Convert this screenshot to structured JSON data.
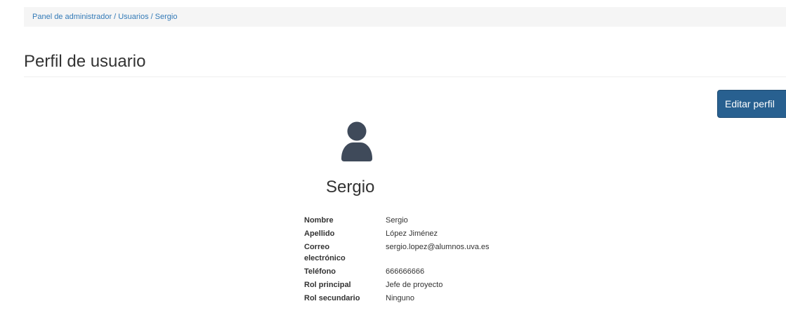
{
  "breadcrumb": {
    "items": [
      "Panel de administrador",
      "Usuarios",
      "Sergio"
    ],
    "separator": "/"
  },
  "page": {
    "title": "Perfil de usuario"
  },
  "actions": {
    "edit_label": "Editar perfil"
  },
  "profile": {
    "avatar_icon": "user-icon",
    "name": "Sergio",
    "fields": {
      "nombre": {
        "label": "Nombre",
        "value": "Sergio"
      },
      "apellido": {
        "label": "Apellido",
        "value": "López Jiménez"
      },
      "correo": {
        "label": "Correo electrónico",
        "value": "sergio.lopez@alumnos.uva.es"
      },
      "telefono": {
        "label": "Teléfono",
        "value": "666666666"
      },
      "rol_principal": {
        "label": "Rol principal",
        "value": "Jefe de proyecto"
      },
      "rol_secundario": {
        "label": "Rol secundario",
        "value": "Ninguno"
      }
    }
  },
  "colors": {
    "link": "#337ab7",
    "primary_button": "#286090",
    "avatar": "#3f4a5a"
  }
}
